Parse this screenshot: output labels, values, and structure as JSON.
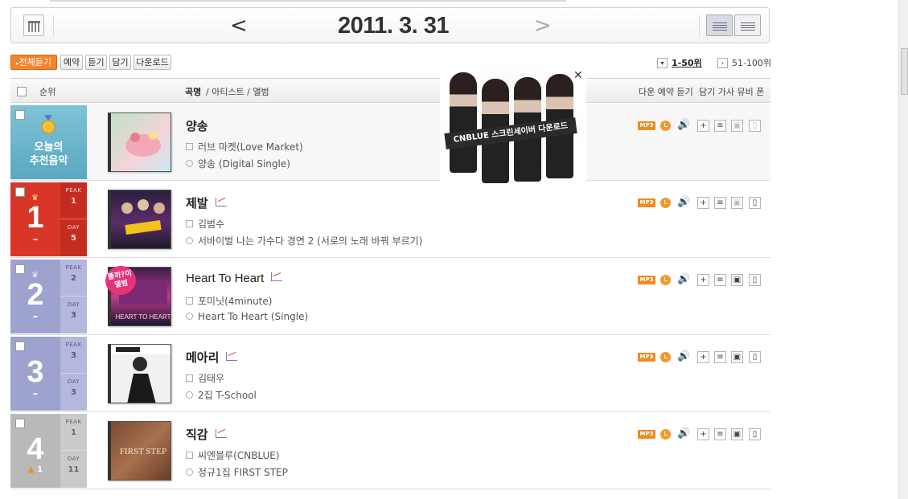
{
  "date_nav": {
    "date": "2011. 3. 31",
    "prev": "<",
    "next": ">"
  },
  "toolbar": {
    "play_all": "전체듣기",
    "reserve": "예약",
    "listen": "듣기",
    "add": "담기",
    "download": "다운로드"
  },
  "pagination": {
    "current": "1-50위",
    "next_range": "51-100위"
  },
  "columns": {
    "rank": "순위",
    "title_part1": "곡명",
    "title_part2": "/ 아티스트 / 앨범",
    "actions_left": "다운 예약 듣기",
    "actions_right": "담기 가사 뮤비 폰"
  },
  "recommended": {
    "label_line1": "오늘의",
    "label_line2": "추천음악",
    "title": "양송",
    "artist": "러브 마켓(Love Market)",
    "album": "양송 (Digital Single)"
  },
  "songs": [
    {
      "rank": "1",
      "change": "–",
      "peak_label": "PEAK",
      "peak": "1",
      "day_label": "DAY",
      "day": "5",
      "title": "제발",
      "artist": "김범수",
      "album": "서바이벌 나는 가수다 경연 2 (서로의 노래 바꿔 부르기)"
    },
    {
      "rank": "2",
      "change": "–",
      "peak_label": "PEAK",
      "peak": "2",
      "day_label": "DAY",
      "day": "3",
      "title": "Heart To Heart",
      "artist": "포미닛(4minute)",
      "album": "Heart To Heart (Single)",
      "badge": "뜰까?이앨범"
    },
    {
      "rank": "3",
      "change": "–",
      "peak_label": "PEAK",
      "peak": "3",
      "day_label": "DAY",
      "day": "3",
      "title": "메아리",
      "artist": "김태우",
      "album": "2집 T-School"
    },
    {
      "rank": "4",
      "change": "1",
      "peak_label": "PEAK",
      "peak": "1",
      "day_label": "DAY",
      "day": "11",
      "title": "직감",
      "artist": "씨엔블루(CNBLUE)",
      "album": "정규1집 FIRST STEP"
    }
  ],
  "icons": {
    "mp3": "MP3"
  },
  "ad": {
    "text": "CNBLUE 스크린세이버 다운로드"
  },
  "colors": {
    "orange": "#f4832e",
    "rank1": "#d9362a",
    "rank_blue": "#9ea2cf",
    "rank_gray": "#b9b9b9",
    "reco": "#6bb6cc"
  }
}
